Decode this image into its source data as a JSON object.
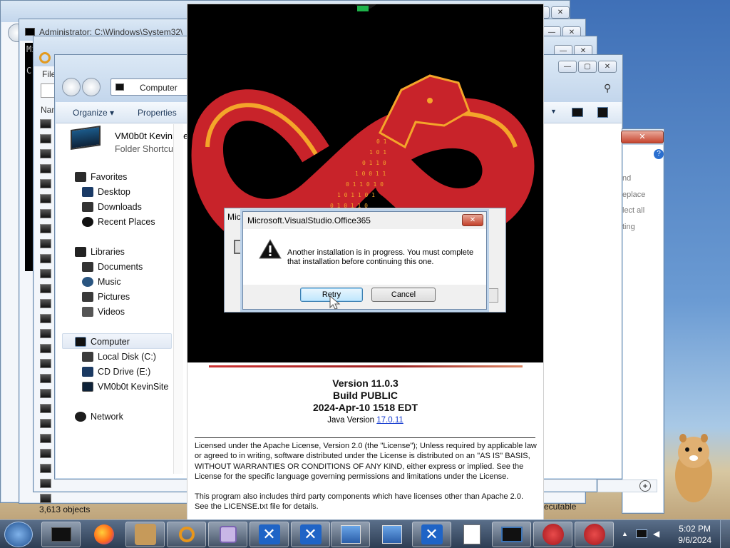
{
  "windows": {
    "cmd_title": "Administrator: C:\\Windows\\System32\\",
    "cmd_text_1": "Mi",
    "cmd_text_2": "C",
    "back_file_label": "File",
    "back_name_header": "Nam",
    "back_status": "3,613 objects",
    "back_status_right": "ecutable"
  },
  "explorer": {
    "address_crumb": "Computer",
    "toolbar": {
      "organize": "Organize ▾",
      "properties": "Properties"
    },
    "selected_item": {
      "name": "VM0b0t KevinSite",
      "type": "Folder Shortcut"
    },
    "nav": {
      "favorites": "Favorites",
      "desktop": "Desktop",
      "downloads": "Downloads",
      "recent": "Recent Places",
      "libraries": "Libraries",
      "documents": "Documents",
      "music": "Music",
      "pictures": "Pictures",
      "videos": "Videos",
      "computer": "Computer",
      "local_disk": "Local Disk (C:)",
      "cd_drive": "CD Drive (E:)",
      "vm_site": "VM0b0t KevinSite",
      "network": "Network"
    }
  },
  "right_window": {
    "items": [
      "nd",
      "eplace",
      "lect all",
      "ting"
    ]
  },
  "splash": {
    "version": "Version 11.0.3",
    "build": "Build PUBLIC",
    "date": "2024-Apr-10 1518 EDT",
    "java_label": "Java Version",
    "java_version": "17.0.11",
    "license_1": "Licensed under the Apache License, Version 2.0 (the \"License\"); Unless required by applicable law or agreed to in writing, software distributed under the License is distributed on an \"AS IS\" BASIS, WITHOUT WARRANTIES OR CONDITIONS OF ANY KIND, either express or implied. See the License for the specific language governing permissions and limitations under the License.",
    "license_2": "This program also includes third party components which have licenses other than Apache 2.0. See the LICENSE.txt file for details."
  },
  "installer": {
    "title": "Mic"
  },
  "dialog": {
    "title": "Microsoft.VisualStudio.Office365",
    "message": "Another installation is in progress. You must complete that installation before continuing this one.",
    "retry": "Retry",
    "cancel": "Cancel",
    "close_glyph": "✕"
  },
  "taskbar": {
    "time": "5:02 PM",
    "date": "9/6/2024",
    "icons": [
      "start-orb",
      "black-box-app",
      "firefox",
      "box-hamster-app",
      "search-tool",
      "window-app",
      "close-x-app-1",
      "close-x-app-2",
      "network-setup-1",
      "network-setup-2",
      "close-x-app-3",
      "document-app",
      "monitor-app",
      "red-dragon-1",
      "red-dragon-2"
    ]
  },
  "colors": {
    "accent_red": "#c8232a",
    "dragon_orange": "#f4a52a",
    "link_blue": "#1a3fd0"
  }
}
